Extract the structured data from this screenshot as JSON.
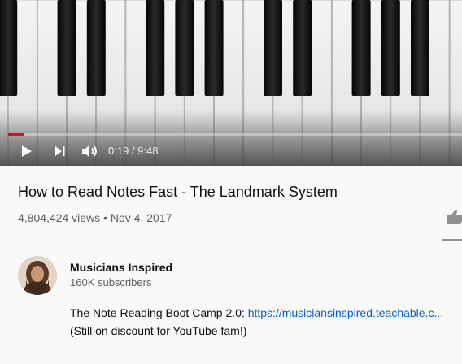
{
  "player": {
    "current_time": "0:19",
    "duration": "9:48",
    "time_separator": " / ",
    "progress_fraction": 0.034,
    "progress_color": "#ff0000",
    "icons": [
      "play-icon",
      "next-icon",
      "volume-icon"
    ]
  },
  "video": {
    "title": "How to Read Notes Fast - The Landmark System",
    "views": "4,804,424 views",
    "date_separator": " • ",
    "date": "Nov 4, 2017"
  },
  "channel": {
    "name": "Musicians Inspired",
    "subscribers": "160K subscribers"
  },
  "description": {
    "line1_text": "The Note Reading Boot Camp 2.0: ",
    "line1_link": "https://musiciansinspired.teachable.c...",
    "line2": "(Still on discount for YouTube fam!)"
  },
  "colors": {
    "link": "#065fd4",
    "text_primary": "#0f0f0f",
    "text_secondary": "#606060"
  }
}
